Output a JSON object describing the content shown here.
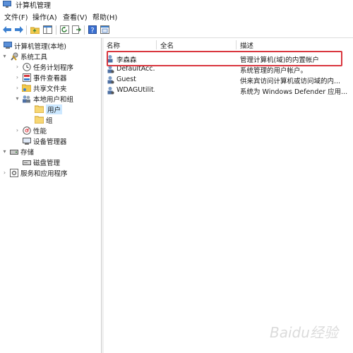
{
  "window": {
    "title": "计算机管理"
  },
  "menu": [
    "文件(F)",
    "操作(A)",
    "查看(V)",
    "帮助(H)"
  ],
  "toolbar": {
    "icons": [
      "back-arrow-icon",
      "forward-arrow-icon",
      "up-folder-icon",
      "show-hide-tree-icon",
      "refresh-icon",
      "export-list-icon",
      "help-icon",
      "properties-icon"
    ]
  },
  "tree": {
    "root": "计算机管理(本地)",
    "system_tools": "系统工具",
    "task_scheduler": "任务计划程序",
    "event_viewer": "事件查看器",
    "shared_folders": "共享文件夹",
    "local_users_groups": "本地用户和组",
    "users": "用户",
    "groups": "组",
    "performance": "性能",
    "device_manager": "设备管理器",
    "storage": "存储",
    "disk_management": "磁盘管理",
    "services_apps": "服务和应用程序"
  },
  "list": {
    "headers": {
      "name": "名称",
      "fullname": "全名",
      "description": "描述"
    },
    "rows": [
      {
        "name": "李森森",
        "fullname": "",
        "description": "管理计算机(域)的内置帐户"
      },
      {
        "name": "DefaultAcc...",
        "fullname": "",
        "description": "系统管理的用户帐户。"
      },
      {
        "name": "Guest",
        "fullname": "",
        "description": "供来宾访问计算机或访问域的内..."
      },
      {
        "name": "WDAGUtilit...",
        "fullname": "",
        "description": "系统为 Windows Defender 应用..."
      }
    ]
  },
  "watermark": {
    "text": "Baidu经验"
  },
  "colors": {
    "highlight_box": "#d9363e",
    "selected_bg": "#cce8ff",
    "folder": "#f2c94c"
  }
}
